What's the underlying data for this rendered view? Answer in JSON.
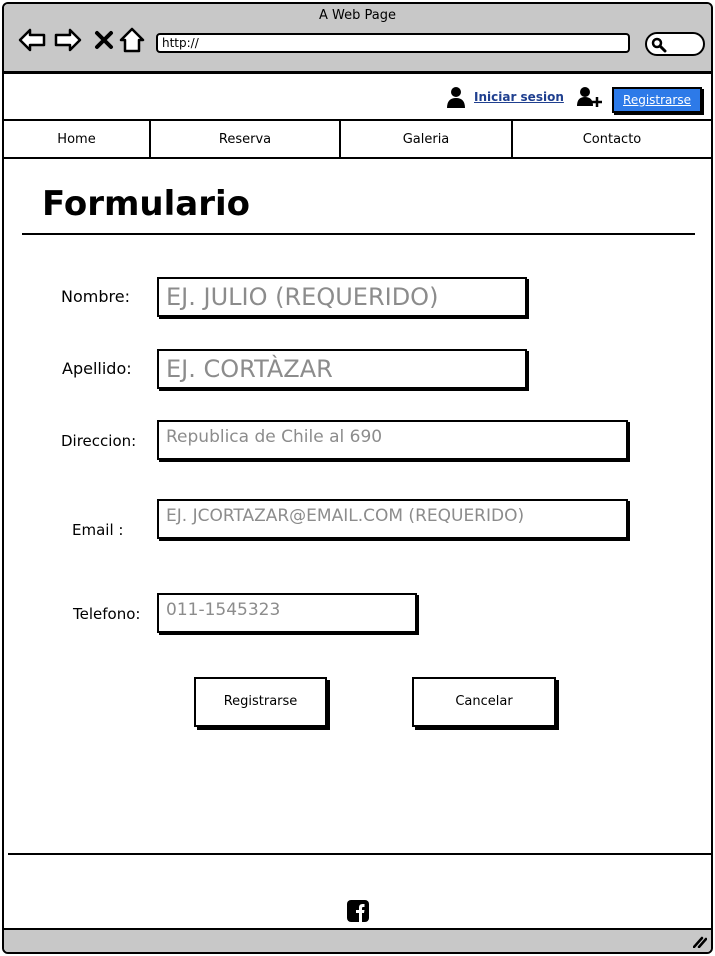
{
  "window": {
    "title": "A Web Page",
    "url": "http://"
  },
  "icons": {
    "back": "arrow-left-icon",
    "forward": "arrow-right-icon",
    "stop": "close-icon",
    "home": "home-icon",
    "search": "search-icon",
    "user": "user-icon",
    "add_user": "add-user-icon",
    "facebook": "facebook-icon",
    "resize": "resize-grip-icon"
  },
  "userbar": {
    "login_label": "Iniciar sesion",
    "register_label": "Registrarse"
  },
  "nav": {
    "tabs": [
      "Home",
      "Reserva",
      "Galeria",
      "Contacto"
    ]
  },
  "form": {
    "title": "Formulario",
    "fields": [
      {
        "label": "Nombre:",
        "placeholder": "EJ. JULIO (REQUERIDO)"
      },
      {
        "label": "Apellido:",
        "placeholder": "EJ. CORTÀZAR"
      },
      {
        "label": "Direccion:",
        "placeholder": "Republica de Chile al 690"
      },
      {
        "label": "Email :",
        "placeholder": "EJ. JCORTAZAR@EMAIL.COM (REQUERIDO)"
      },
      {
        "label": "Telefono:",
        "placeholder": "011-1545323"
      }
    ],
    "submit_label": "Registrarse",
    "cancel_label": "Cancelar"
  },
  "colors": {
    "chrome": "#c8c8c8",
    "accent_button": "#2d7ae8",
    "link": "#1f3f8f",
    "placeholder": "#8c8c8c"
  }
}
